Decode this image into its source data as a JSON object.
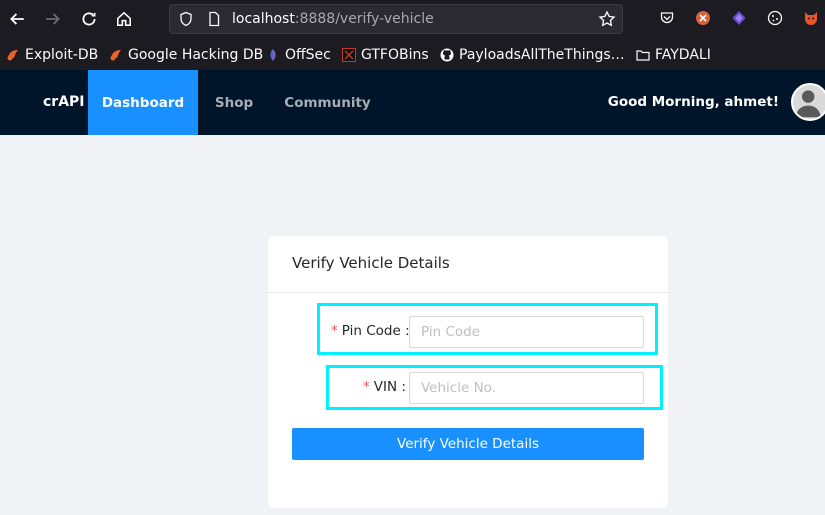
{
  "browser": {
    "url_host": "localhost",
    "url_path": ":8888/verify-vehicle"
  },
  "bookmarks": [
    {
      "label": "Exploit-DB",
      "icon": "exploit-db-icon"
    },
    {
      "label": "Google Hacking DB",
      "icon": "ghdb-icon"
    },
    {
      "label": "OffSec",
      "icon": "offsec-icon"
    },
    {
      "label": "GTFOBins",
      "icon": "gtfobins-icon"
    },
    {
      "label": "PayloadsAllTheThings…",
      "icon": "github-icon"
    },
    {
      "label": "FAYDALI",
      "icon": "folder-icon"
    }
  ],
  "app": {
    "brand": "crAPI",
    "nav": [
      {
        "label": "Dashboard",
        "active": true
      },
      {
        "label": "Shop",
        "active": false
      },
      {
        "label": "Community",
        "active": false
      }
    ],
    "greeting": "Good Morning, ahmet!"
  },
  "form": {
    "title": "Verify Vehicle Details",
    "pin_label": "Pin Code",
    "pin_placeholder": "Pin Code",
    "vin_label": "VIN",
    "vin_placeholder": "Vehicle No.",
    "required_mark": "*",
    "label_suffix": ":",
    "submit_label": "Verify Vehicle Details"
  },
  "colors": {
    "accent": "#1890ff",
    "header_bg": "#001529",
    "highlight": "#00f0ff",
    "required": "#ff4d4f"
  }
}
